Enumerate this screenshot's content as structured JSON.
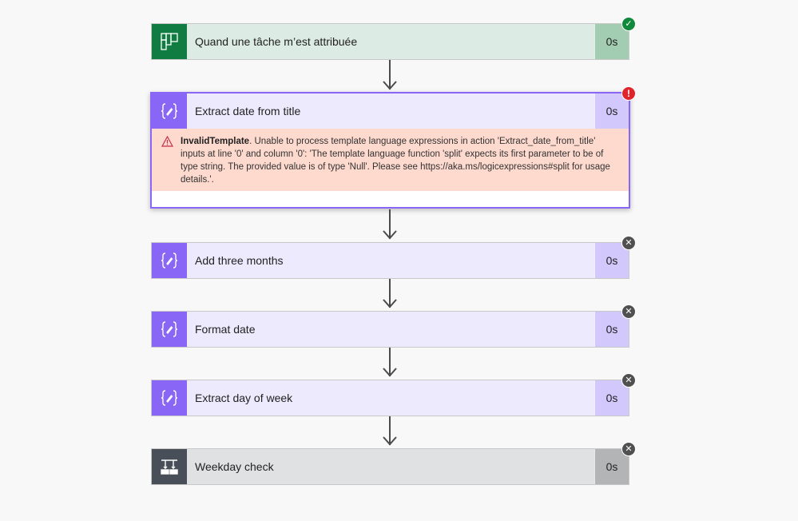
{
  "flow": {
    "steps": [
      {
        "title": "Quand une tâche m’est attribuée",
        "duration": "0s",
        "icon": "planner-icon",
        "status": "succeeded",
        "status_icon": "checkmark-icon",
        "color": "#107c41"
      },
      {
        "title": "Extract date from title",
        "duration": "0s",
        "icon": "compose-expression-icon",
        "status": "failed",
        "status_icon": "exclamation-icon",
        "color": "#8a66f6",
        "error": {
          "icon": "warning-icon",
          "code": "InvalidTemplate",
          "message": ". Unable to process template language expressions in action 'Extract_date_from_title' inputs at line '0' and column '0': 'The template language function 'split' expects its first parameter to be of type string. The provided value is of type 'Null'. Please see https://aka.ms/logicexpressions#split for usage details.'."
        }
      },
      {
        "title": "Add three months",
        "duration": "0s",
        "icon": "compose-expression-icon",
        "status": "skipped",
        "status_icon": "close-icon",
        "color": "#8a66f6"
      },
      {
        "title": "Format date",
        "duration": "0s",
        "icon": "compose-expression-icon",
        "status": "skipped",
        "status_icon": "close-icon",
        "color": "#8a66f6"
      },
      {
        "title": "Extract day of week",
        "duration": "0s",
        "icon": "compose-expression-icon",
        "status": "skipped",
        "status_icon": "close-icon",
        "color": "#8a66f6"
      },
      {
        "title": "Weekday check",
        "duration": "0s",
        "icon": "condition-icon",
        "status": "skipped",
        "status_icon": "close-icon",
        "color": "#484f58"
      }
    ],
    "badges": {
      "success": "✓",
      "error": "!",
      "skip": "✕"
    }
  }
}
